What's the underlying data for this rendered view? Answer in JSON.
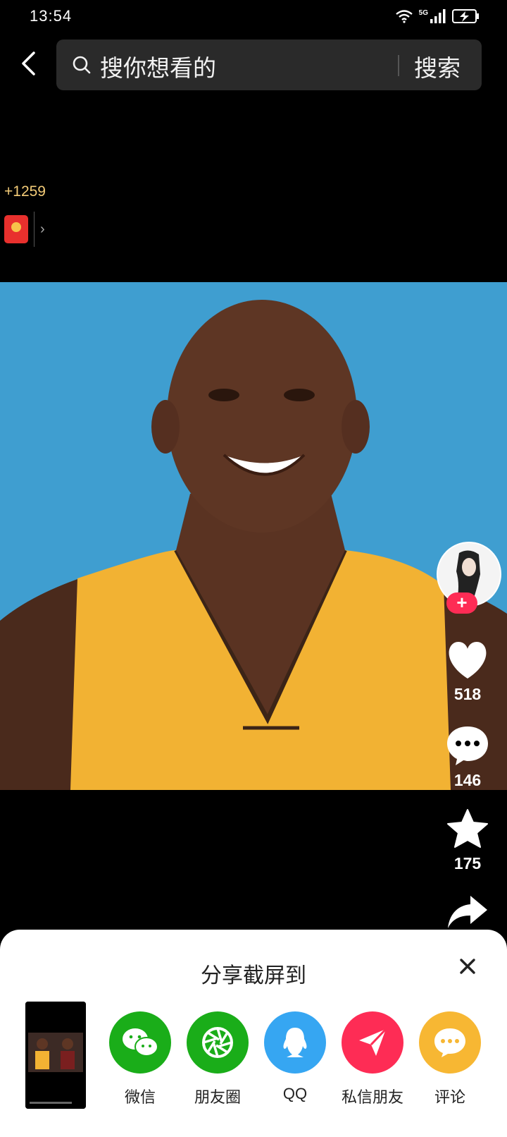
{
  "status": {
    "time": "13:54",
    "network": "5G"
  },
  "search": {
    "placeholder": "搜你想看的",
    "button": "搜索"
  },
  "reward": {
    "count": "+1259"
  },
  "actions": {
    "likes": "518",
    "comments": "146",
    "favorites": "175"
  },
  "share_sheet": {
    "title": "分享截屏到",
    "items": [
      {
        "label": "微信",
        "color": "#1aad19",
        "icon": "wechat-icon"
      },
      {
        "label": "朋友圈",
        "color": "#1aad19",
        "icon": "moments-icon"
      },
      {
        "label": "QQ",
        "color": "#36a6f2",
        "icon": "qq-icon"
      },
      {
        "label": "私信朋友",
        "color": "#fe2c55",
        "icon": "send-icon"
      },
      {
        "label": "评论",
        "color": "#f7b733",
        "icon": "comment-icon"
      }
    ]
  },
  "colors": {
    "accent": "#fe2c55",
    "reward": "#f4cc78",
    "video_bg": "#3f9ed0",
    "jersey": "#f2b233"
  }
}
